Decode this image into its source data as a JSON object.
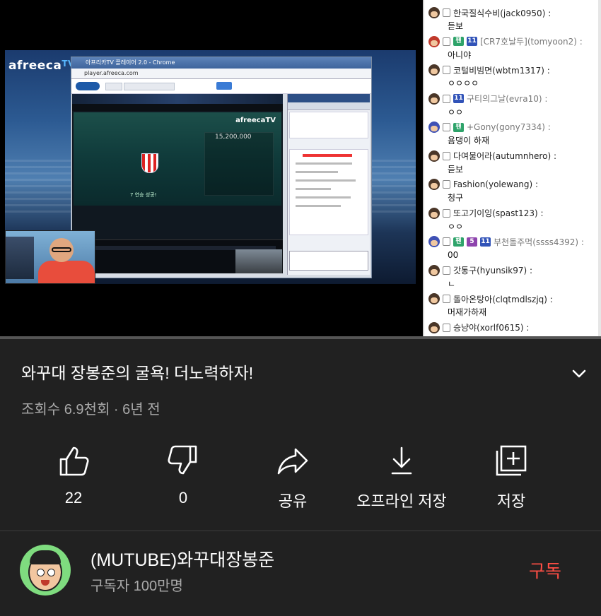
{
  "player": {
    "stream": {
      "logo": "afreeca",
      "logo_tv": "TV",
      "browser_title": "아프리카TV 플레이어 2.0 - Chrome",
      "url": "player.afreeca.com",
      "banner_score": "15,200,000",
      "promo_text": "7 연승 성공!"
    },
    "progress": 0.0,
    "colors": {
      "progress_fill": "#ff0000",
      "progress_track": "#555555"
    }
  },
  "live_chat": {
    "messages": [
      {
        "avatar": "smile-face",
        "badges": [],
        "nick": "한국질식수비(jack0950) :",
        "text": "듣보"
      },
      {
        "avatar": "mario-red",
        "badges": [
          "팬",
          "11"
        ],
        "nick": "[CR7호날두](tomyoon2) :",
        "text": "아니야"
      },
      {
        "avatar": "face",
        "badges": [],
        "nick": "코털비빔면(wbtm1317) :",
        "text": "ㅇㅇㅇㅇ"
      },
      {
        "avatar": "face",
        "badges": [
          "11"
        ],
        "nick": "구티의그날(evra10) :",
        "text": "ㅇㅇ"
      },
      {
        "avatar": "face-blue",
        "badges": [
          "팬"
        ],
        "nick": "+Gony(gony7334) :",
        "text": "욤댕이 하재"
      },
      {
        "avatar": "face",
        "badges": [],
        "nick": "다여물어라(autumnhero) :",
        "text": "듣보"
      },
      {
        "avatar": "face",
        "badges": [],
        "nick": "Fashion(yolewang) :",
        "text": "청구"
      },
      {
        "avatar": "face",
        "badges": [],
        "nick": "또고기이잉(spast123) :",
        "text": "ㅇㅇ"
      },
      {
        "avatar": "face-blue",
        "badges": [
          "팬",
          "5",
          "11"
        ],
        "nick": "부천돌주먹(ssss4392) :",
        "text": "00"
      },
      {
        "avatar": "face",
        "badges": [],
        "nick": "갓통구(hyunsik97) :",
        "text": "ㄴ"
      },
      {
        "avatar": "face",
        "badges": [],
        "nick": "돌아온탕아(clqtmdlszjq) :",
        "text": "머재가하재"
      },
      {
        "avatar": "face",
        "badges": [],
        "nick": "승냥야(xorlf0615) :",
        "text": ""
      }
    ]
  },
  "video": {
    "title": "와꾸대 장봉준의 굴욕! 더노력하자!",
    "views": "조회수 6.9천회",
    "separator": "·",
    "age": "6년 전"
  },
  "actions": {
    "like": {
      "icon": "thumbs-up-icon",
      "label": "22"
    },
    "dislike": {
      "icon": "thumbs-down-icon",
      "label": "0"
    },
    "share": {
      "icon": "share-icon",
      "label": "공유"
    },
    "download": {
      "icon": "download-icon",
      "label": "오프라인 저장"
    },
    "save": {
      "icon": "save-playlist-icon",
      "label": "저장"
    }
  },
  "channel": {
    "name": "(MUTUBE)와꾸대장봉준",
    "subscribers": "구독자 100만명",
    "subscribe_label": "구독",
    "subscribe_color": "#ff4e45"
  }
}
